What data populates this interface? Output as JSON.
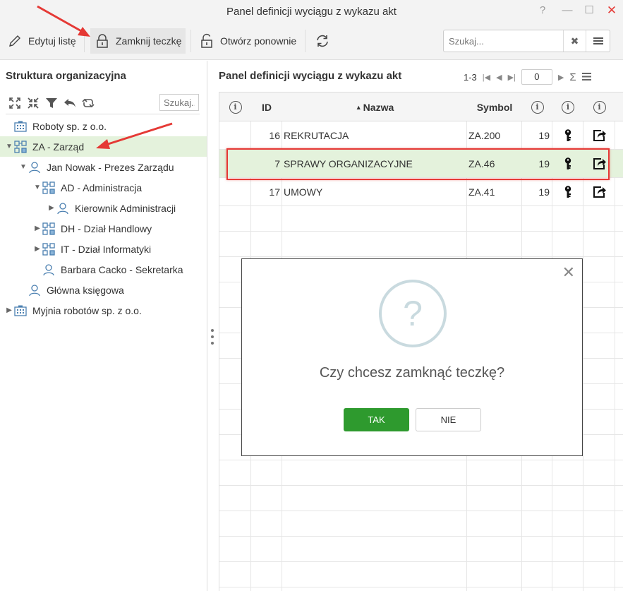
{
  "window": {
    "title": "Panel definicji wyciągu z wykazu akt",
    "controls": [
      "?",
      "—",
      "☐",
      "✕"
    ]
  },
  "toolbar": {
    "edit_label": "Edytuj listę",
    "close_folder_label": "Zamknij teczkę",
    "reopen_label": "Otwórz ponownie",
    "search_placeholder": "Szukaj..."
  },
  "left_panel": {
    "title": "Struktura organizacyjna",
    "search_placeholder": "Szukaj...",
    "tree": [
      {
        "label": "Roboty sp. z o.o.",
        "icon": "company-icon",
        "level": 0,
        "caret": ""
      },
      {
        "label": "ZA - Zarząd",
        "icon": "department-icon",
        "level": 0,
        "caret": "expanded",
        "selected": true
      },
      {
        "label": "Jan Nowak - Prezes Zarządu",
        "icon": "person-icon",
        "level": 1,
        "caret": "expanded"
      },
      {
        "label": "AD - Administracja",
        "icon": "department-icon",
        "level": 2,
        "caret": "expanded"
      },
      {
        "label": "Kierownik Administracji",
        "icon": "person-icon",
        "level": 3,
        "caret": "collapsed"
      },
      {
        "label": "DH - Dział Handlowy",
        "icon": "department-icon",
        "level": 2,
        "caret": "collapsed"
      },
      {
        "label": "IT - Dział Informatyki",
        "icon": "department-icon",
        "level": 2,
        "caret": "collapsed"
      },
      {
        "label": "Barbara Cacko - Sekretarka",
        "icon": "person-icon",
        "level": 2,
        "caret": ""
      },
      {
        "label": "Główna księgowa",
        "icon": "person-icon",
        "level": 1,
        "caret": ""
      },
      {
        "label": "Myjnia robotów sp. z o.o.",
        "icon": "company-icon",
        "level": 0,
        "caret": "collapsed"
      }
    ]
  },
  "right_panel": {
    "title": "Panel definicji wyciągu z wykazu akt",
    "pager": {
      "range": "1-3",
      "page": "0"
    },
    "columns": {
      "id": "ID",
      "name": "Nazwa",
      "symbol": "Symbol"
    },
    "rows": [
      {
        "id": "16",
        "name": "REKRUTACJA",
        "symbol": "ZA.200",
        "count": "19",
        "selected": false
      },
      {
        "id": "7",
        "name": "SPRAWY ORGANIZACYJNE",
        "symbol": "ZA.46",
        "count": "19",
        "selected": true
      },
      {
        "id": "17",
        "name": "UMOWY",
        "symbol": "ZA.41",
        "count": "19",
        "selected": false
      }
    ]
  },
  "dialog": {
    "icon": "question-icon",
    "question_glyph": "?",
    "message": "Czy chcesz zamknąć teczkę?",
    "yes_label": "TAK",
    "no_label": "NIE"
  },
  "colors": {
    "accent_green": "#2e9a2e",
    "selection": "#e4f2dc",
    "annotation_red": "#e53935"
  }
}
